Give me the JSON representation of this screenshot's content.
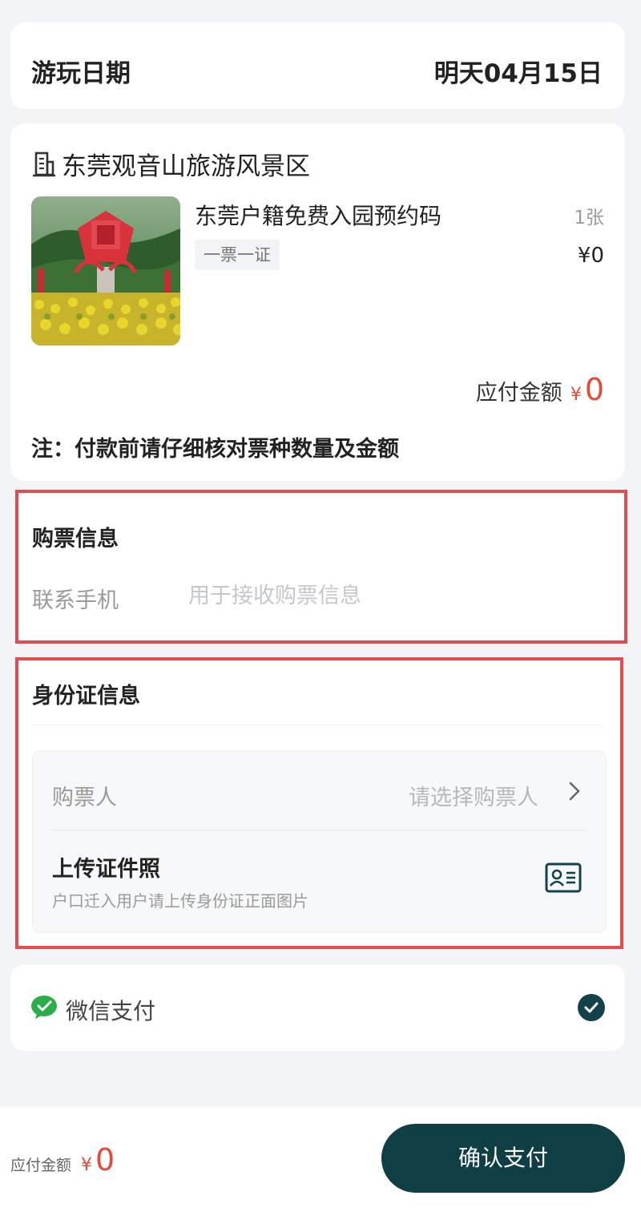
{
  "date_card": {
    "label": "游玩日期",
    "value": "明天04月15日"
  },
  "order": {
    "scenic_icon": "building-icon",
    "scenic_name": "东莞观音山旅游风景区",
    "product": {
      "title": "东莞户籍免费入园预约码",
      "quantity": "1张",
      "tag": "一票一证",
      "price": "¥0"
    },
    "amount_due": {
      "label": "应付金额",
      "currency": "¥",
      "value": "0"
    },
    "note": "注：付款前请仔细核对票种数量及金额"
  },
  "ticket_info": {
    "heading": "购票信息",
    "phone_label": "联系手机",
    "phone_placeholder": "用于接收购票信息"
  },
  "id_info": {
    "heading": "身份证信息",
    "buyer_label": "购票人",
    "buyer_placeholder": "请选择购票人",
    "upload_title": "上传证件照",
    "upload_subtitle": "户口迁入用户请上传身份证正面图片",
    "upload_icon": "id-card-icon"
  },
  "payment": {
    "icon": "wechat-pay-icon",
    "label": "微信支付",
    "selected_icon": "check-circle-icon",
    "selected": true
  },
  "bottom_bar": {
    "amount_label": "应付金额",
    "currency": "¥",
    "amount_value": "0",
    "confirm_label": "确认支付"
  },
  "colors": {
    "accent": "#0f3f44",
    "price_red": "#e34a3a",
    "highlight_border": "#e24d52",
    "wechat_green": "#2bae4a"
  }
}
